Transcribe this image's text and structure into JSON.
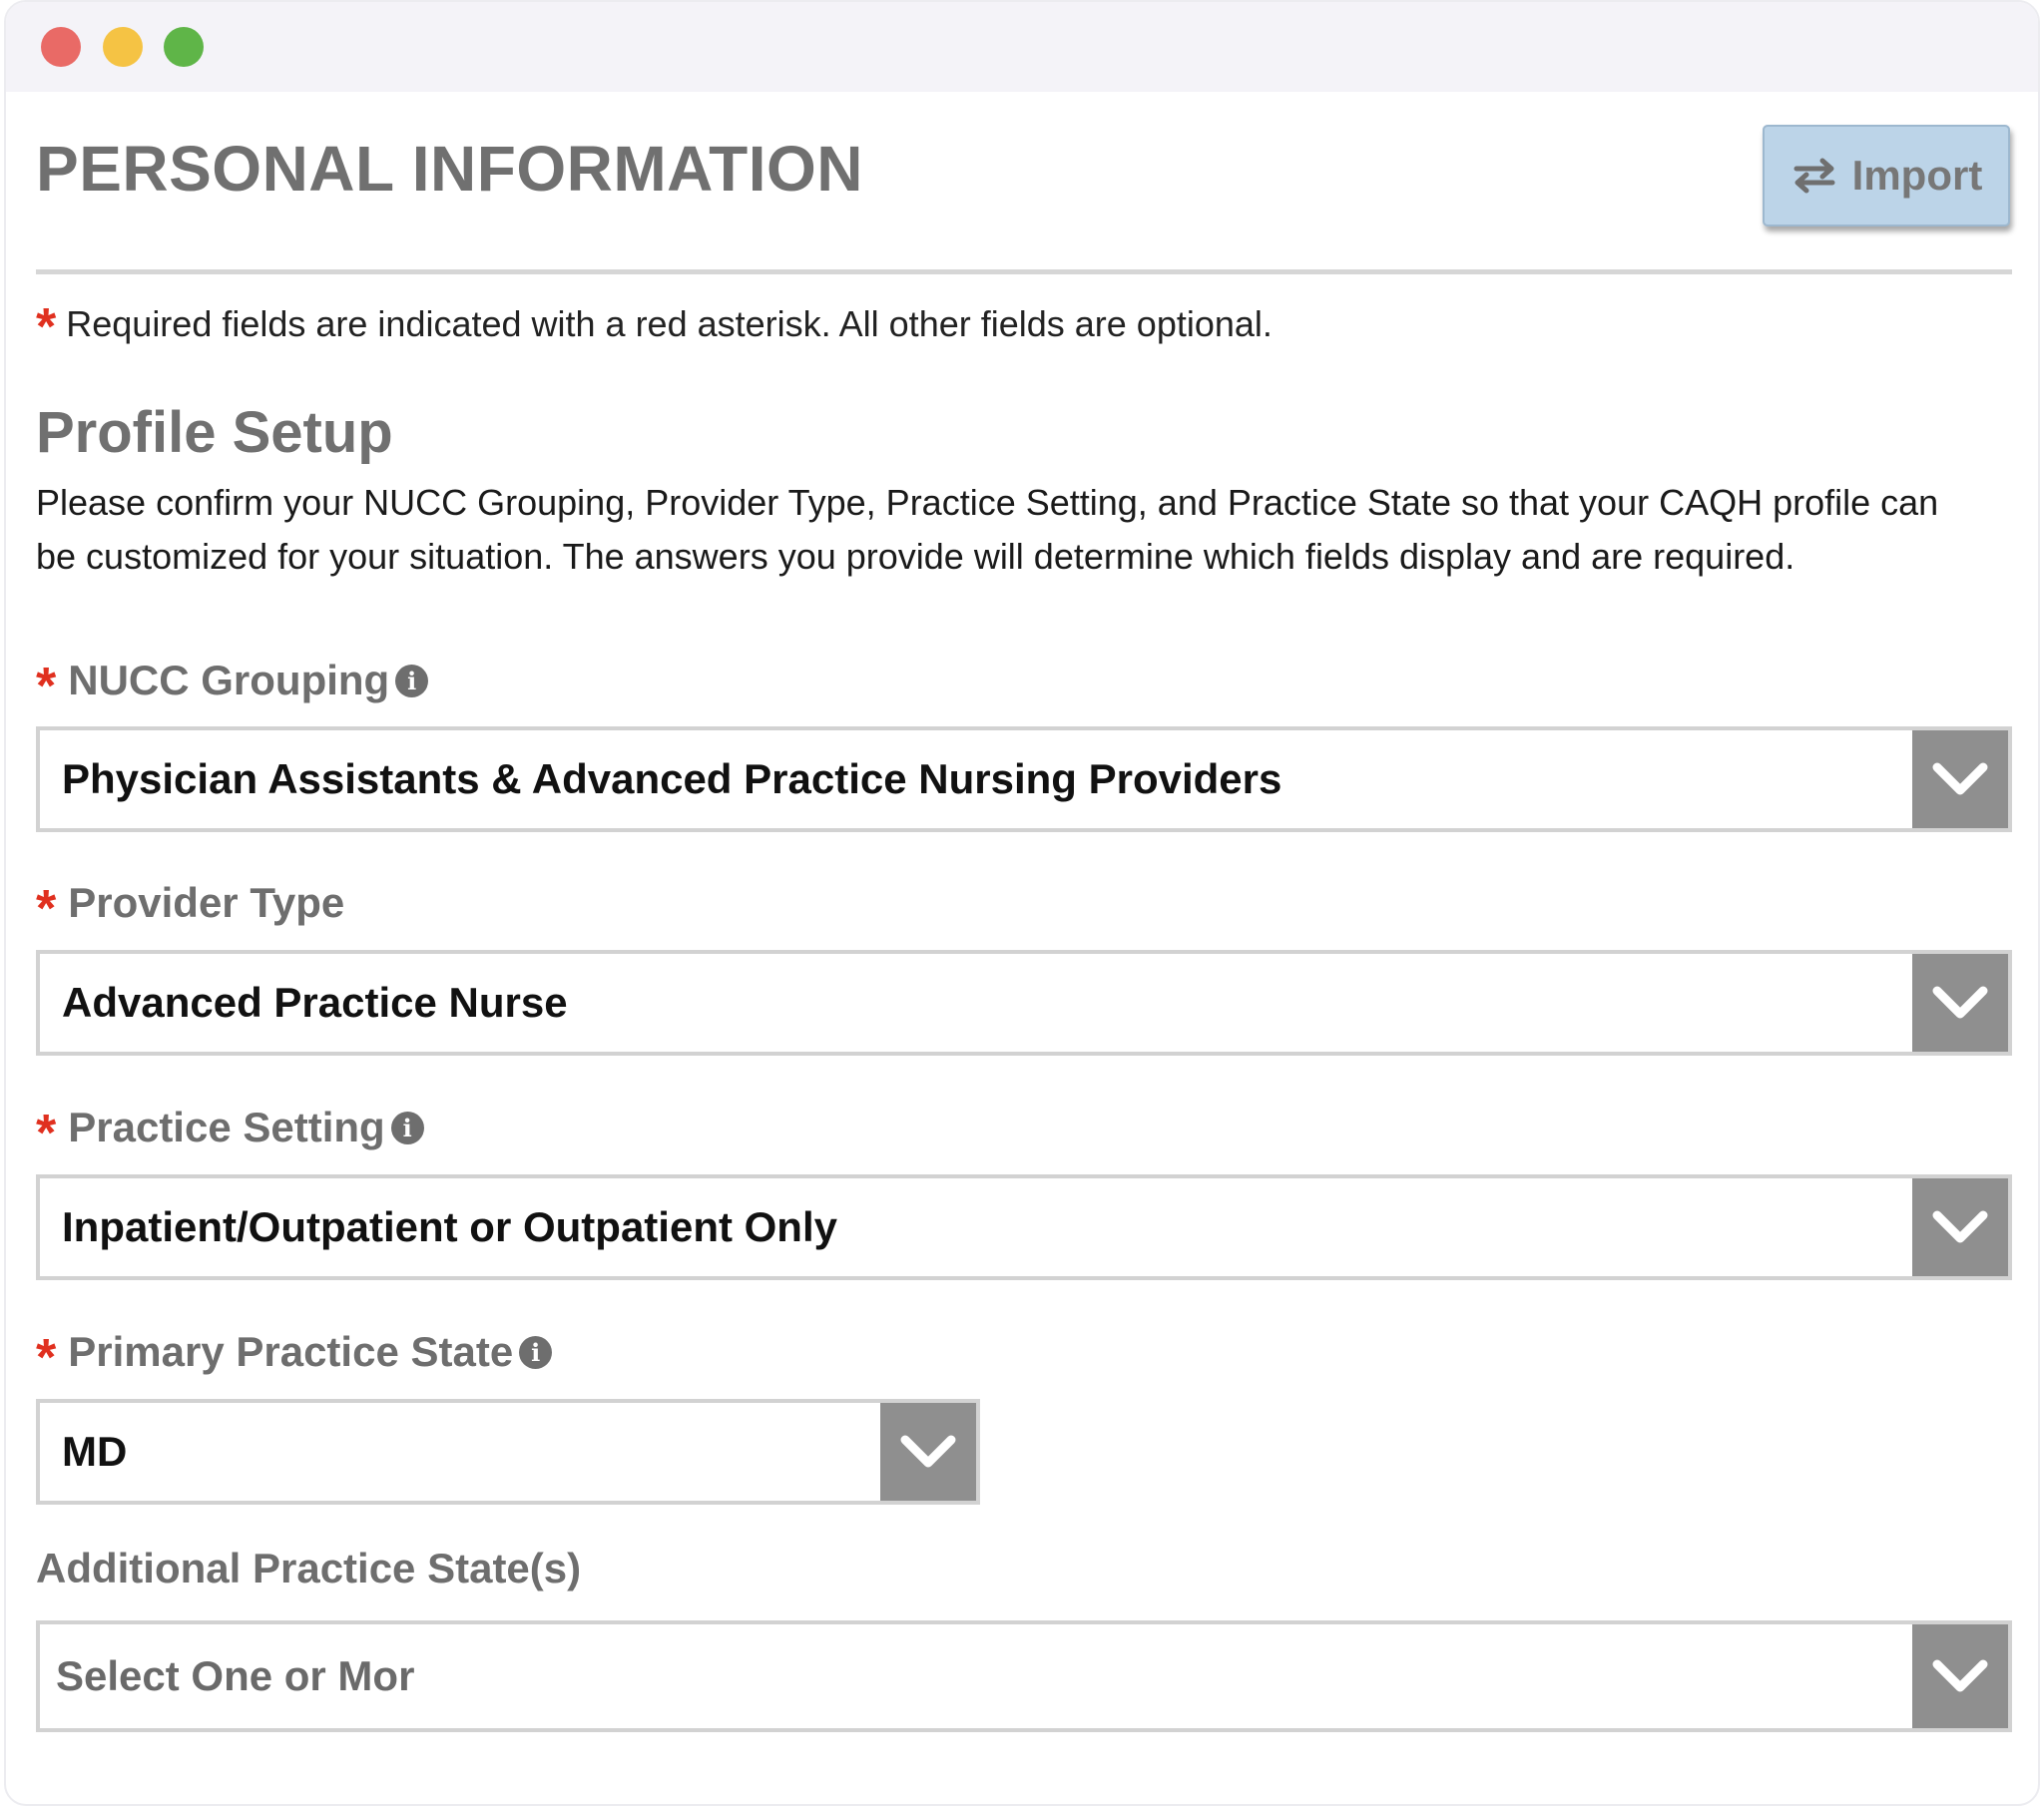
{
  "page": {
    "title": "PERSONAL INFORMATION",
    "import_button": "Import",
    "required_note": "Required fields are indicated with a red asterisk. All other fields are optional.",
    "asterisk": "*"
  },
  "profile_setup": {
    "title": "Profile Setup",
    "intro_line1": "Please confirm your NUCC Grouping, Provider Type, Practice Setting, and Practice State so that your CAQH profile can",
    "intro_line2": "be customized for your situation. The answers you provide will determine which fields display and are required."
  },
  "fields": [
    {
      "label": "NUCC Grouping",
      "value": "Physician Assistants & Advanced Practice Nursing Providers"
    },
    {
      "label": "Provider Type",
      "value": "Advanced Practice Nurse"
    },
    {
      "label": "Practice Setting",
      "value": "Inpatient/Outpatient or Outpatient Only"
    },
    {
      "label": "Primary Practice State",
      "value": "MD"
    },
    {
      "label": "Additional Practice State(s)",
      "placeholder": "Select One or Mor"
    }
  ],
  "icons": {
    "info": "info-icon",
    "import": "swap-arrows-icon",
    "dropdown": "chevron-down-icon"
  },
  "colors": {
    "required_asterisk": "#e0301f",
    "import_button_bg": "#bcd4e8",
    "dropdown_arrow_bg": "#8f8f8f",
    "label_gray": "#6e6e6e"
  }
}
